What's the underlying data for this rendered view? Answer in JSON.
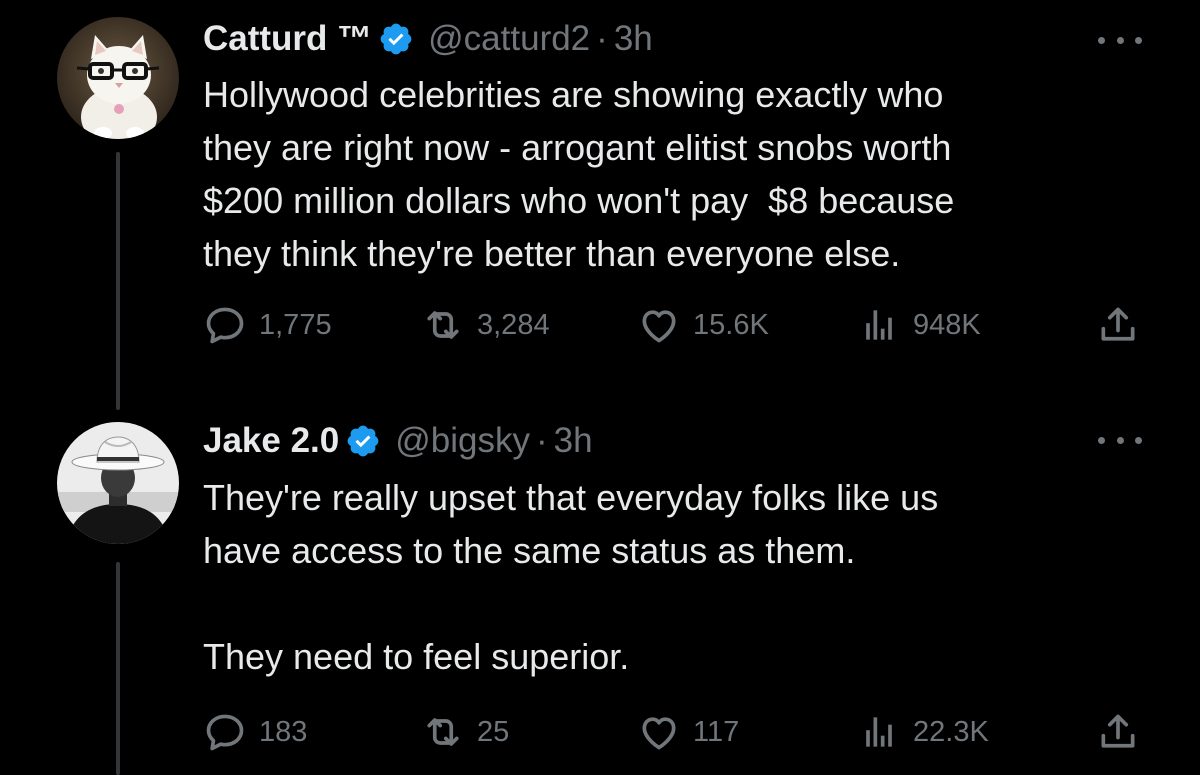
{
  "tweets": [
    {
      "author": {
        "name": "Catturd ™",
        "handle": "@catturd2",
        "verified": true,
        "avatar": "cat-with-glasses-avatar"
      },
      "separator": "·",
      "time": "3h",
      "text": "Hollywood celebrities are showing exactly who\nthey are right now - arrogant elitist snobs worth\n$200 million dollars who won't pay  $8 because\nthey think they're better than everyone else.",
      "stats": {
        "replies": "1,775",
        "retweets": "3,284",
        "likes": "15.6K",
        "views": "948K"
      }
    },
    {
      "author": {
        "name": "Jake 2.0",
        "handle": "@bigsky",
        "verified": true,
        "avatar": "man-with-cowboy-hat-avatar"
      },
      "separator": "·",
      "time": "3h",
      "text": "They're really upset that everyday folks like us\nhave access to the same status as them.\n\nThey need to feel superior.",
      "stats": {
        "replies": "183",
        "retweets": "25",
        "likes": "117",
        "views": "22.3K"
      }
    }
  ],
  "colors": {
    "background": "#000000",
    "text_primary": "#e7e9ea",
    "text_secondary": "#71767b",
    "verified_badge": "#1d9bf0",
    "thread_line": "#333639"
  },
  "icons": {
    "reply": "reply-icon",
    "retweet": "retweet-icon",
    "like": "heart-icon",
    "views": "views-chart-icon",
    "share": "share-icon",
    "more": "more-options-icon",
    "verified": "verified-badge-icon"
  }
}
